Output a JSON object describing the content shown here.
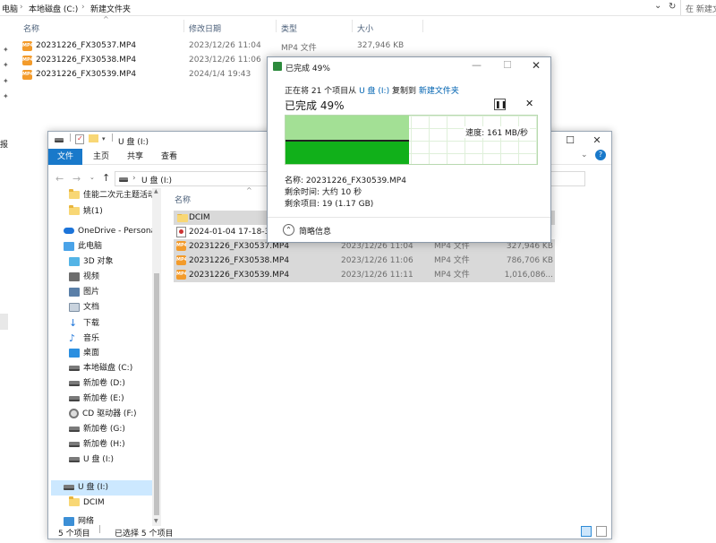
{
  "back_window": {
    "breadcrumb": [
      "电脑",
      "本地磁盘 (C:)",
      "新建文件夹"
    ],
    "search_placeholder": "在 新建文件夹",
    "columns": [
      "名称",
      "修改日期",
      "类型",
      "大小"
    ],
    "files": [
      {
        "name": "20231226_FX30537.MP4",
        "date": "2023/12/26 11:04",
        "type": "MP4 文件",
        "size": "327,946 KB"
      },
      {
        "name": "20231226_FX30538.MP4",
        "date": "2023/12/26 11:06",
        "type": "",
        "size": ""
      },
      {
        "name": "20231226_FX30539.MP4",
        "date": "2024/1/4 19:43",
        "type": "",
        "size": ""
      }
    ],
    "side_fragment": "报"
  },
  "explorer": {
    "title": "U 盘 (I:)",
    "ribbon_tabs": [
      "文件",
      "主页",
      "共享",
      "查看"
    ],
    "address": [
      "U 盘 (I:)"
    ],
    "column_name": "名称",
    "sidebar": [
      {
        "label": "佳能二次元主题活动",
        "icon": "folder"
      },
      {
        "label": "姚(1)",
        "icon": "folder"
      },
      {
        "label": "OneDrive - Persona",
        "icon": "cloud"
      },
      {
        "label": "此电脑",
        "icon": "pc"
      },
      {
        "label": "3D 对象",
        "icon": "3d"
      },
      {
        "label": "视频",
        "icon": "video"
      },
      {
        "label": "图片",
        "icon": "pictures"
      },
      {
        "label": "文档",
        "icon": "documents"
      },
      {
        "label": "下载",
        "icon": "download"
      },
      {
        "label": "音乐",
        "icon": "music"
      },
      {
        "label": "桌面",
        "icon": "desktop"
      },
      {
        "label": "本地磁盘 (C:)",
        "icon": "drive"
      },
      {
        "label": "新加卷 (D:)",
        "icon": "drive"
      },
      {
        "label": "新加卷 (E:)",
        "icon": "drive"
      },
      {
        "label": "CD 驱动器 (F:)",
        "icon": "cd"
      },
      {
        "label": "新加卷 (G:)",
        "icon": "drive"
      },
      {
        "label": "新加卷 (H:)",
        "icon": "drive"
      },
      {
        "label": "U 盘 (I:)",
        "icon": "drive"
      },
      {
        "label": "U 盘 (I:)",
        "icon": "drive"
      },
      {
        "label": "DCIM",
        "icon": "folder"
      },
      {
        "label": "网络",
        "icon": "network"
      }
    ],
    "files": [
      {
        "name": "DCIM",
        "date": "",
        "type": "",
        "size": "",
        "icon": "folder",
        "selected": true
      },
      {
        "name": "2024-01-04 17-18-30",
        "date": "",
        "type": "",
        "size": "",
        "icon": "video",
        "selected": false
      },
      {
        "name": "20231226_FX30537.MP4",
        "date": "2023/12/26 11:04",
        "type": "MP4 文件",
        "size": "327,946 KB",
        "icon": "mp4",
        "selected": true
      },
      {
        "name": "20231226_FX30538.MP4",
        "date": "2023/12/26 11:06",
        "type": "MP4 文件",
        "size": "786,706 KB",
        "icon": "mp4",
        "selected": true
      },
      {
        "name": "20231226_FX30539.MP4",
        "date": "2023/12/26 11:11",
        "type": "MP4 文件",
        "size": "1,016,086...",
        "icon": "mp4",
        "selected": true
      }
    ],
    "status": {
      "count": "5 个项目",
      "selected": "已选择 5 个项目"
    }
  },
  "copy_dialog": {
    "title": "已完成 49%",
    "progress_label_prefix": "正在将 21 个项目从",
    "source": "U 盘 (I:)",
    "progress_label_mid": "复制到",
    "destination": "新建文件夹",
    "headline": "已完成 49%",
    "progress": 0.49,
    "speed": "速度: 161 MB/秒",
    "name_line": "名称: 20231226_FX30539.MP4",
    "time_line": "剩余时间: 大约 10 秒",
    "items_line": "剩余项目: 19 (1.17 GB)",
    "less_details": "简略信息"
  },
  "colors": {
    "progress_fill": "#11b01a",
    "progress_history": "#a3e095",
    "ribbon_file": "#1979ca",
    "link": "#0063b1"
  }
}
